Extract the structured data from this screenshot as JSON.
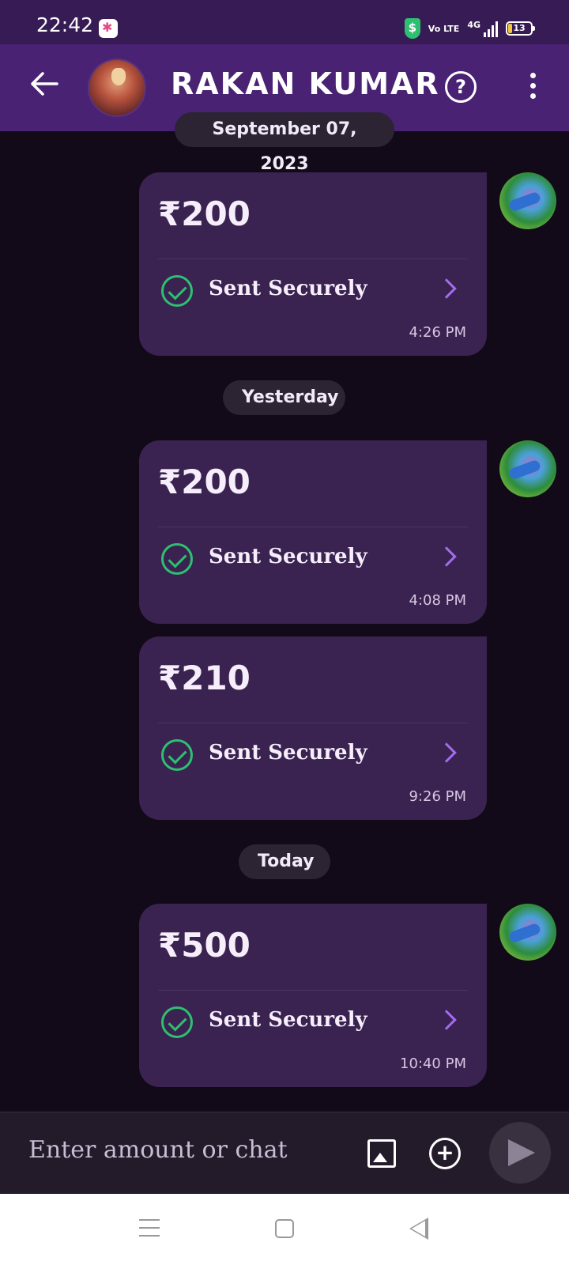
{
  "status_bar": {
    "time": "22:42",
    "network": "4G",
    "volte": "Vo LTE",
    "battery": "13"
  },
  "header": {
    "contact_name": "RAKAN KUMAR",
    "help_label": "?"
  },
  "messages": [
    {
      "date_pill": "September 07, 2023",
      "amount": "₹200",
      "status": "Sent Securely",
      "time": "4:26 PM"
    },
    {
      "date_pill": "Yesterday",
      "amount": "₹200",
      "status": "Sent Securely",
      "time": "4:08 PM"
    },
    {
      "date_pill": "",
      "amount": "₹210",
      "status": "Sent Securely",
      "time": "9:26 PM"
    },
    {
      "date_pill": "Today",
      "amount": "₹500",
      "status": "Sent Securely",
      "time": "10:40 PM"
    }
  ],
  "input": {
    "placeholder": "Enter amount or chat"
  },
  "colors": {
    "header_bg": "#4a2273",
    "card_bg": "#3a2350",
    "success": "#2fbf71",
    "accent": "#a46bf0"
  }
}
